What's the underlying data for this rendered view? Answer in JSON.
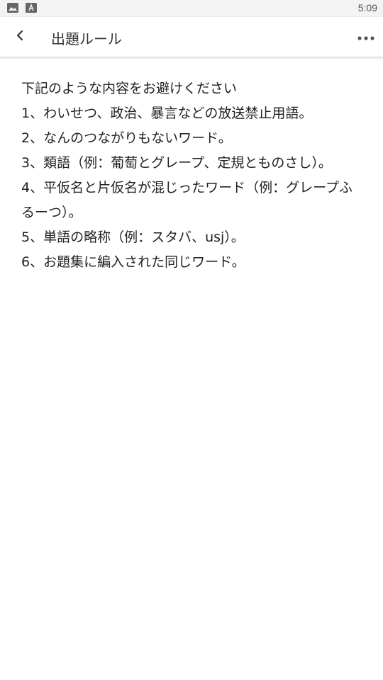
{
  "status_bar": {
    "time": "5:09",
    "icons": [
      "image-icon",
      "font-download-icon"
    ]
  },
  "app_bar": {
    "title": "出題ルール",
    "back_icon": "chevron-left-icon",
    "more_icon": "more-horiz-icon"
  },
  "rules": {
    "intro": "下記のような内容をお避けください",
    "items": [
      "1、わいせつ、政治、暴言などの放送禁止用語。",
      "2、なんのつながりもないワード。",
      "3、類語（例：葡萄とグレープ、定規とものさし）。",
      "4、平仮名と片仮名が混じったワード（例：グレープふるーつ）。",
      "5、単語の略称（例：スタバ、usj）。",
      "6、お題集に編入された同じワード。"
    ]
  }
}
